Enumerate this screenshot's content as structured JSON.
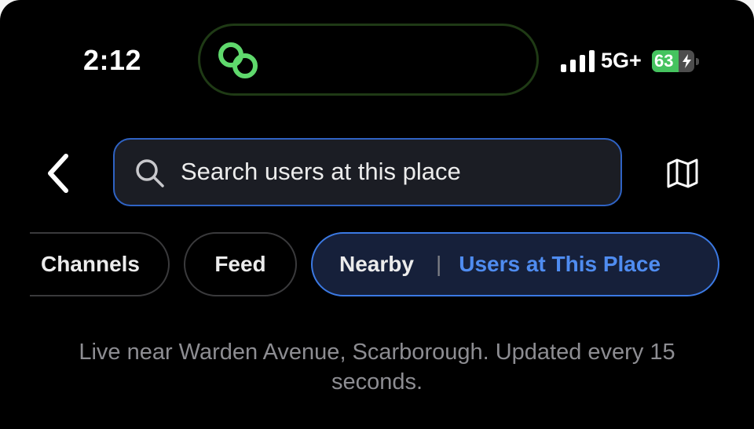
{
  "status_bar": {
    "time": "2:12",
    "network": "5G+",
    "battery_percent": 63,
    "battery_label": "63",
    "battery_charging": true,
    "island_icon": "link-icon",
    "island_icon_color": "#5fd86c"
  },
  "header": {
    "back_icon": "chevron-left-icon",
    "search": {
      "placeholder": "Search users at this place",
      "value": ""
    },
    "map_icon": "map-icon"
  },
  "chips": [
    {
      "label": "Channels",
      "active": false
    },
    {
      "label": "Feed",
      "active": false
    },
    {
      "label": "Nearby",
      "active": true,
      "main": "Users at This Place",
      "divider": "|"
    }
  ],
  "live_status": "Live near Warden Avenue, Scarborough. Updated every 15 seconds.",
  "colors": {
    "accent": "#4f8cf0",
    "background": "#000000",
    "battery_green": "#45c35f"
  }
}
